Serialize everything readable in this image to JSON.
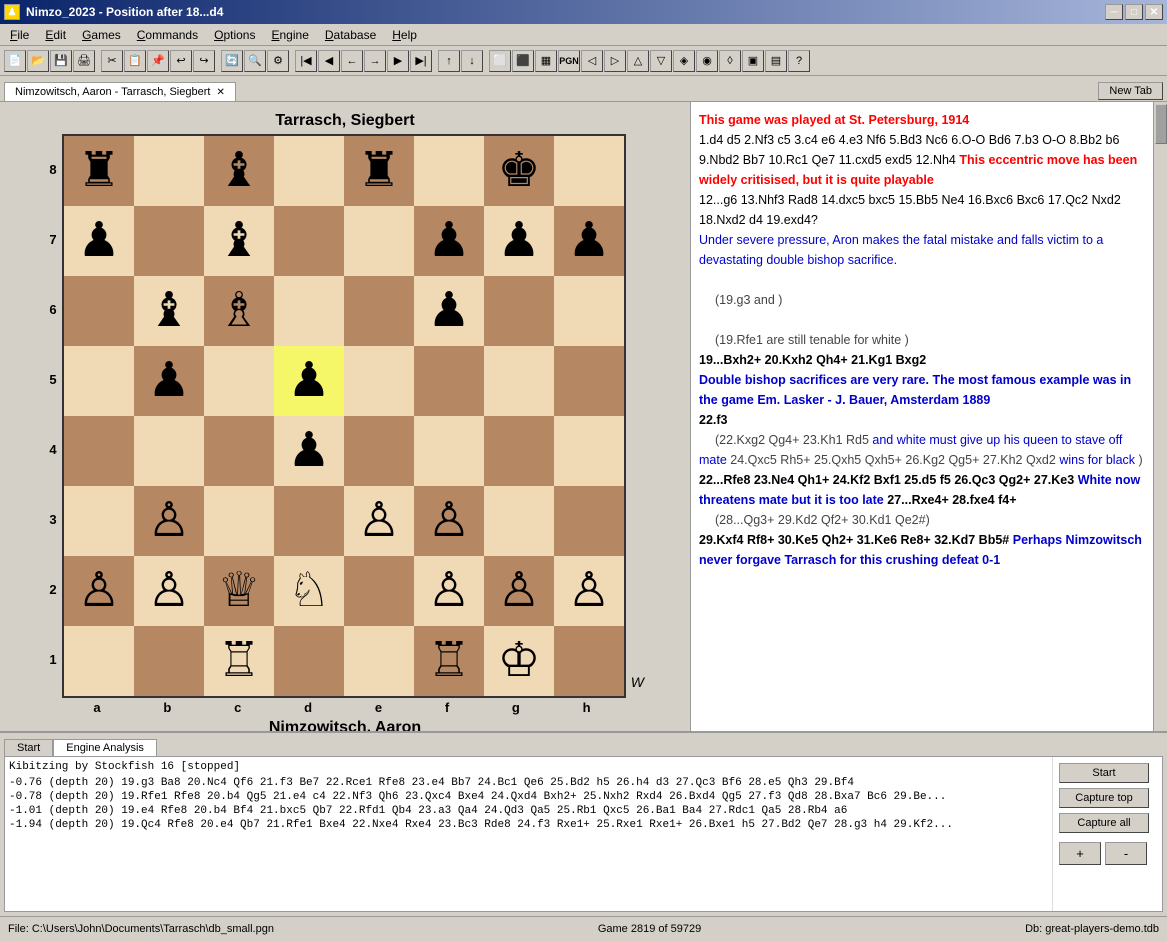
{
  "titlebar": {
    "icon": "♟",
    "title": "Nimzo_2023  -  Position after 18...d4",
    "min": "─",
    "max": "□",
    "close": "✕"
  },
  "menu": {
    "items": [
      "File",
      "Edit",
      "Games",
      "Commands",
      "Options",
      "Engine",
      "Database",
      "Help"
    ]
  },
  "tab": {
    "label": "Nimzowitsch, Aaron - Tarrasch, Siegbert",
    "new_tab": "New Tab"
  },
  "board": {
    "top_player": "Tarrasch, Siegbert",
    "bottom_player": "Nimzowitsch, Aaron",
    "ranks": [
      "8",
      "7",
      "6",
      "5",
      "4",
      "3",
      "2",
      "1"
    ],
    "files": [
      "a",
      "b",
      "c",
      "d",
      "e",
      "f",
      "g",
      "h"
    ],
    "w_label": "W"
  },
  "game_text": {
    "header": "This game was played at St. Petersburg, 1914",
    "moves": "1.d4 d5 2.Nf3 c5 3.c4 e6 4.e3 Nf6 5.Bd3 Nc6 6.O-O Bd6 7.b3 O-O 8.Bb2 b6 9.Nbd2 Bb7 10.Rc1 Qe7 11.cxd5 exd5 12.Nh4",
    "comment1": "This eccentric move has been widely critisised, but it is quite playable",
    "moves2": "12...g6 13.Nhf3 Rad8 14.dxc5 bxc5 15.Bb5 Ne4 16.Bxc6 Bxc6 17.Qc2 Nxd2 18.Nxd2 d4 19.exd4?",
    "comment2": "Under severe pressure,  Aron makes the fatal mistake and falls victim to a devastating double bishop sacrifice.",
    "variation1": "(19.g3  and )",
    "variation2": "(19.Rfe1  are still tenable for white )",
    "moves3": "19...Bxh2+ 20.Kxh2 Qh4+ 21.Kg1 Bxg2",
    "comment3": "Double bishop sacrifices are very rare. The most famous example was in the game Em. Lasker - J. Bauer, Amsterdam 1889",
    "moves4": "22.f3",
    "variation3": "(22.Kxg2 Qg4+ 23.Kh1 Rd5  and white must give up his queen to stave off mate 24.Qxc5 Rh5+ 25.Qxh5 Qxh5+ 26.Kg2 Qg5+ 27.Kh2 Qxd2  wins for black )",
    "moves5": "22...Rfe8 23.Ne4 Qh1+ 24.Kf2 Bxf1 25.d5 f5 26.Qc3 Qg2+ 27.Ke3",
    "comment4": "White now threatens mate but it is too late",
    "moves6": "27...Rxe4+ 28.fxe4 f4+",
    "variation4": "(28...Qg3+ 29.Kd2 Qf2+ 30.Kd1 Qe2#)",
    "moves7": "29.Kxf4 Rf8+ 30.Ke5 Qh2+ 31.Ke6 Re8+ 32.Kd7 Bb5#",
    "comment5": "Perhaps Nimzowitsch never forgave Tarrasch for this crushing defeat 0-1"
  },
  "bottom_tabs": {
    "tab1": "Start",
    "tab2": "Engine Analysis"
  },
  "engine": {
    "header": "Kibitzing by Stockfish 16 [stopped]",
    "lines": [
      "-0.76 (depth 20) 19.g3 Ba8 20.Nc4 Qf6 21.f3 Be7 22.Rce1 Rfe8 23.e4 Bb7 24.Bc1 Qe6 25.Bd2 h5 26.h4 d3 27.Qc3 Bf6 28.e5 Qh3 29.Bf4",
      "-0.78 (depth 20) 19.Rfe1 Rfe8 20.b4 Qg5 21.e4 c4 22.Nf3 Qh6 23.Qxc4 Bxe4 24.Qxd4 Bxh2+ 25.Nxh2 Rxd4 26.Bxd4 Qg5 27.f3 Qd8 28.Bxa7 Bc6 29.Be...",
      "-1.01 (depth 20) 19.e4 Rfe8 20.b4 Bf4 21.bxc5 Qb7 22.Rfd1 Qb4 23.a3 Qa4 24.Qd3 Qa5 25.Rb1 Qxc5 26.Ba1 Ba4 27.Rdc1 Qa5 28.Rb4 a6",
      "-1.94 (depth 20) 19.Qc4 Rfe8 20.e4 Qb7 21.Rfe1 Bxe4 22.Nxe4 Rxe4 23.Bc3 Rde8 24.f3 Rxe1+ 25.Rxe1 Rxe1+ 26.Bxe1 h5 27.Bd2 Qe7 28.g3 h4 29.Kf2..."
    ],
    "buttons": {
      "start": "Start",
      "capture_top": "Capture top",
      "capture_all": "Capture all",
      "plus": "+",
      "minus": "-"
    }
  },
  "status": {
    "file": "File: C:\\Users\\John\\Documents\\Tarrasch\\db_small.pgn",
    "game": "Game 2819 of 59729",
    "db": "Db: great-players-demo.tdb"
  },
  "board_pieces": {
    "layout": [
      [
        "♜",
        "",
        "♝",
        "",
        "♜",
        "",
        "♚",
        ""
      ],
      [
        "♟",
        "",
        "♝",
        "",
        "",
        "♟",
        "♟",
        "♟"
      ],
      [
        "",
        "♝",
        "♗",
        "",
        "",
        "♟",
        "",
        ""
      ],
      [
        "",
        "♟",
        "",
        "♟",
        "",
        "",
        "",
        ""
      ],
      [
        "",
        "",
        "",
        "♟",
        "",
        "",
        "",
        ""
      ],
      [
        "",
        "♙",
        "",
        "",
        "♙",
        "♙",
        "",
        ""
      ],
      [
        "♙",
        "♙",
        "♕",
        "♘",
        "",
        "♙",
        "♙",
        "♙"
      ],
      [
        "",
        "",
        "♖",
        "",
        "",
        "♖",
        "♔",
        ""
      ]
    ]
  }
}
